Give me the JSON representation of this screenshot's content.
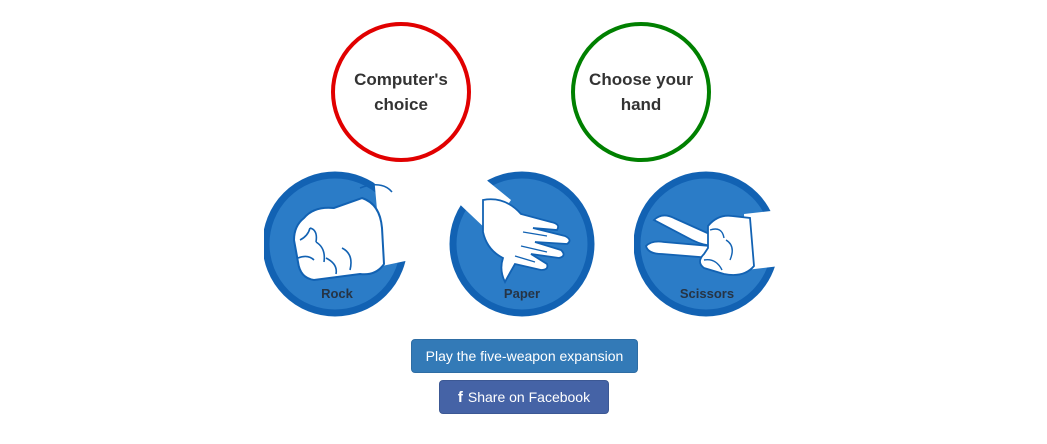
{
  "colors": {
    "computer_ring": "#e10000",
    "player_ring": "#008000",
    "hand_circle": "#2b7cc7",
    "hand_border": "#1262b3",
    "expansion_button": "#337ab7",
    "facebook_button": "#4563a6"
  },
  "status": {
    "computer_line1": "Computer's",
    "computer_line2": "choice",
    "player_line1": "Choose your",
    "player_line2": "hand"
  },
  "hands": [
    {
      "label": "Rock",
      "icon": "rock-fist-icon"
    },
    {
      "label": "Paper",
      "icon": "paper-open-hand-icon"
    },
    {
      "label": "Scissors",
      "icon": "scissors-two-fingers-icon"
    }
  ],
  "buttons": {
    "expansion_label": "Play the five-weapon expansion",
    "facebook_icon": "facebook-icon",
    "facebook_label": "Share on Facebook"
  }
}
